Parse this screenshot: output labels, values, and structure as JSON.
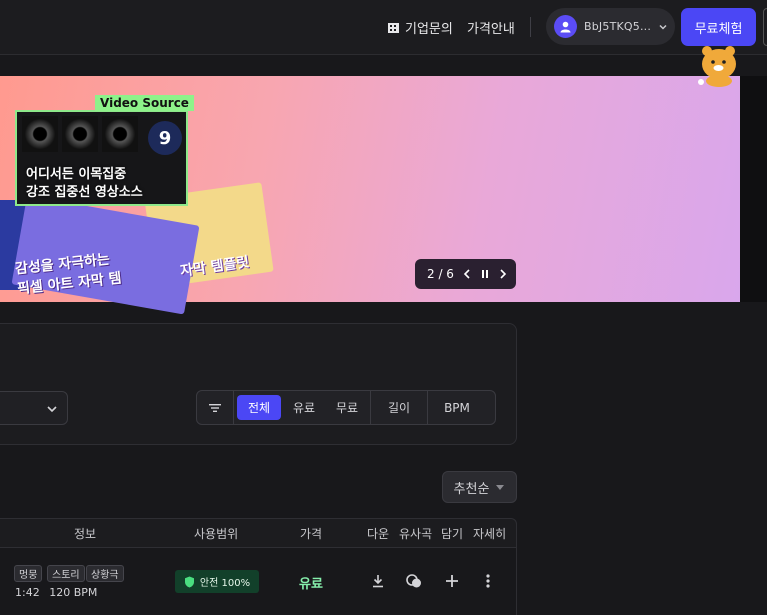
{
  "header": {
    "enterprise_label": "기업문의",
    "pricing_label": "가격안내",
    "user_name": "BbJ5TKQ5...",
    "free_trial_label": "무료체험"
  },
  "banner": {
    "video_source_label": "Video Source",
    "video_title_line1": "어디서든 이목집중",
    "video_title_line2": "강조 집중선 영상소스",
    "badge_number": "9",
    "pixel_title_line1": "감성을 자극하는",
    "pixel_title_line2": "픽셀 아트 자막 템",
    "sticker_text": "자막 템플릿",
    "slide_counter": "2 / 6"
  },
  "filters": {
    "segments": [
      "전체",
      "유료",
      "무료",
      "길이",
      "BPM"
    ],
    "active_segment": "전체"
  },
  "sort": {
    "label": "추천순"
  },
  "table": {
    "headers": [
      "정보",
      "사용범위",
      "가격",
      "다운",
      "유사곡",
      "담기",
      "자세히"
    ],
    "rows": [
      {
        "tags": [
          "멍뭉",
          "스토리",
          "상황극"
        ],
        "duration": "1:42",
        "bpm": "120 BPM",
        "usage": "안전 100%",
        "price": "유료"
      }
    ]
  },
  "colors": {
    "accent": "#4b47f5",
    "paid_green": "#86efac",
    "safe_badge_bg": "#12402a"
  }
}
